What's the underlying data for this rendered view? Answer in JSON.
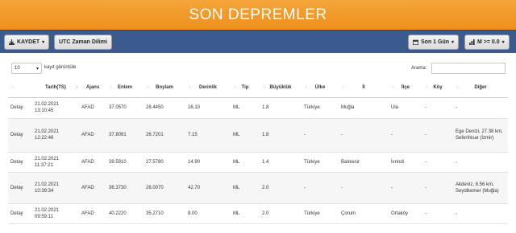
{
  "header": {
    "title": "SON DEPREMLER"
  },
  "toolbar": {
    "kaydet_label": "KAYDET",
    "utc_label": "UTC Zaman Dilimi",
    "period_label": "Son 1 Gün",
    "mag_label": "M >= 0.0"
  },
  "controls": {
    "page_length": "10",
    "page_length_suffix": "kayıt görüntüle",
    "search_label": "Arama:",
    "search_value": ""
  },
  "table": {
    "headers": [
      "",
      "Tarih(TS)",
      "Ajans",
      "Enlem",
      "Boylam",
      "Derinlik",
      "Tip",
      "Büyüklük",
      "Ülke",
      "İl",
      "İlçe",
      "Köy",
      "Diğer"
    ],
    "rows": [
      {
        "link": "Detay",
        "date": "21.02.2021",
        "time": "13:10:45",
        "agency": "AFAD",
        "lat": "37.0570",
        "lon": "28.4450",
        "depth": "16.10",
        "type": "ML",
        "mag": "1.8",
        "country": "Türkiye",
        "province": "Muğla",
        "district": "Ula",
        "village": "-",
        "other": "-"
      },
      {
        "link": "Detay",
        "date": "21.02.2021",
        "time": "12:22:46",
        "agency": "AFAD",
        "lat": "37.8091",
        "lon": "26.7201",
        "depth": "7.15",
        "type": "ML",
        "mag": "1.8",
        "country": "-",
        "province": "-",
        "district": "-",
        "village": "-",
        "other": "Ege Denizi, 27.38 km, Seferihisar (İzmir)"
      },
      {
        "link": "Detay",
        "date": "21.02.2021",
        "time": "11:37:21",
        "agency": "AFAD",
        "lat": "39.5910",
        "lon": "27.5780",
        "depth": "14.90",
        "type": "ML",
        "mag": "1.4",
        "country": "Türkiye",
        "province": "Balıkesir",
        "district": "İvrindi",
        "village": "-",
        "other": "-"
      },
      {
        "link": "Detay",
        "date": "21.02.2021",
        "time": "10:39:34",
        "agency": "AFAD",
        "lat": "36.3730",
        "lon": "28.0070",
        "depth": "42.70",
        "type": "ML",
        "mag": "2.0",
        "country": "-",
        "province": "-",
        "district": "-",
        "village": "-",
        "other": "Akdeniz, 8.56 km, Seydikemer (Muğla)"
      },
      {
        "link": "Detay",
        "date": "21.02.2021",
        "time": "09:59:11",
        "agency": "AFAD",
        "lat": "40.2220",
        "lon": "35.2710",
        "depth": "8.00",
        "type": "ML",
        "mag": "2.0",
        "country": "Türkiye",
        "province": "Çorum",
        "district": "Ortaköy",
        "village": "-",
        "other": "-"
      }
    ]
  },
  "icons": {
    "download": "download-icon",
    "calendar": "calendar-icon",
    "chart": "bar-chart-icon",
    "sort": "sort-arrows-icon"
  }
}
